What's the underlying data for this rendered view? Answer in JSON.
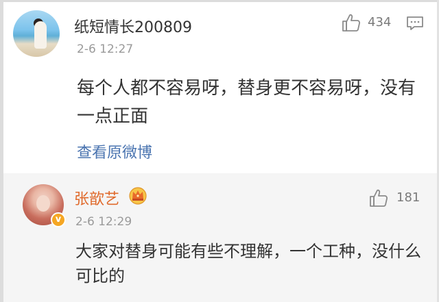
{
  "main_comment": {
    "username": "纸短情长200809",
    "timestamp": "2-6 12:27",
    "like_count": "434",
    "text": "每个人都不容易呀，替身更不容易呀，没有一点正面",
    "view_original_label": "查看原微博"
  },
  "reply_comment": {
    "username": "张歆艺",
    "timestamp": "2-6 12:29",
    "like_count": "181",
    "text": "大家对替身可能有些不理解，一个工种，没什么可比的",
    "verified_badge": "v"
  },
  "colors": {
    "username_highlight": "#e06a2c",
    "link": "#4a74b0",
    "meta_text": "#9a9a9a",
    "reply_bg": "#f5f5f5"
  },
  "icons": [
    "thumbs-up-icon",
    "reply-icon",
    "crown-icon",
    "verified-badge-icon"
  ]
}
